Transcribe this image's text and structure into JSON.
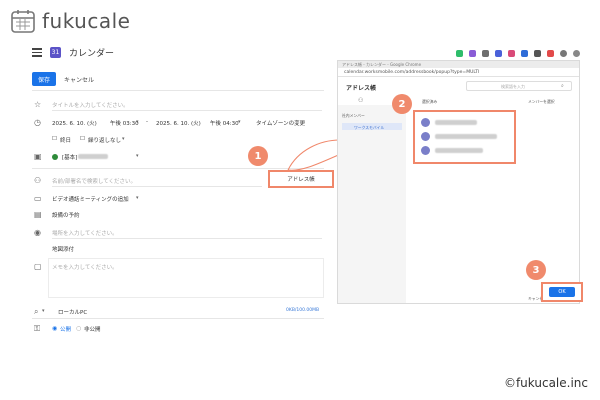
{
  "brand": {
    "name": "fukucale",
    "copyright": "©fukucale.inc"
  },
  "calendar": {
    "title": "カレンダー",
    "badge": "31",
    "save_label": "保存",
    "cancel_label": "キャンセル"
  },
  "form": {
    "title_placeholder": "タイトルを入力してください。",
    "start_date": "2025. 6. 10. (火)",
    "start_time": "午後 03:30",
    "dash": "-",
    "end_date": "2025. 6. 10. (火)",
    "end_time": "午後 04:30",
    "timezone": "タイムゾーンの変更",
    "all_day": "終日",
    "repeat": "繰り返しなし",
    "calendar_name": "[基本]",
    "guest_placeholder": "名前/部署名で検索してください。",
    "video": "ビデオ通話ミーティングの追加",
    "facility": "設備の予約",
    "place_placeholder": "場所を入力してください。",
    "map": "地図添付",
    "memo_placeholder": "メモを入力してください。",
    "attach": "ローカルPC",
    "attach_size": "0KB/100.00MB",
    "public": "公開",
    "private": "非公開",
    "address_book_button": "アドレス帳"
  },
  "popup": {
    "bar_title": "アドレス帳 - カレンダー - Google Chrome",
    "url": "calendar.worksmobile.com/addressbook/popup?type=MULTI",
    "title": "アドレス帳",
    "search_placeholder": "検索語を入力",
    "left_section": "社内メンバー",
    "left_item": "ワークスモバイル",
    "selected_header": "選択済み",
    "right_header": "メンバーを選択",
    "contacts": [
      {
        "id": "1"
      },
      {
        "id": "2"
      },
      {
        "id": "3"
      }
    ],
    "cancel_label": "キャンセル",
    "ok_label": "OK"
  },
  "steps": [
    "1",
    "2",
    "3"
  ],
  "colors": {
    "accent": "#f0876a",
    "primary": "#1a73e8"
  }
}
